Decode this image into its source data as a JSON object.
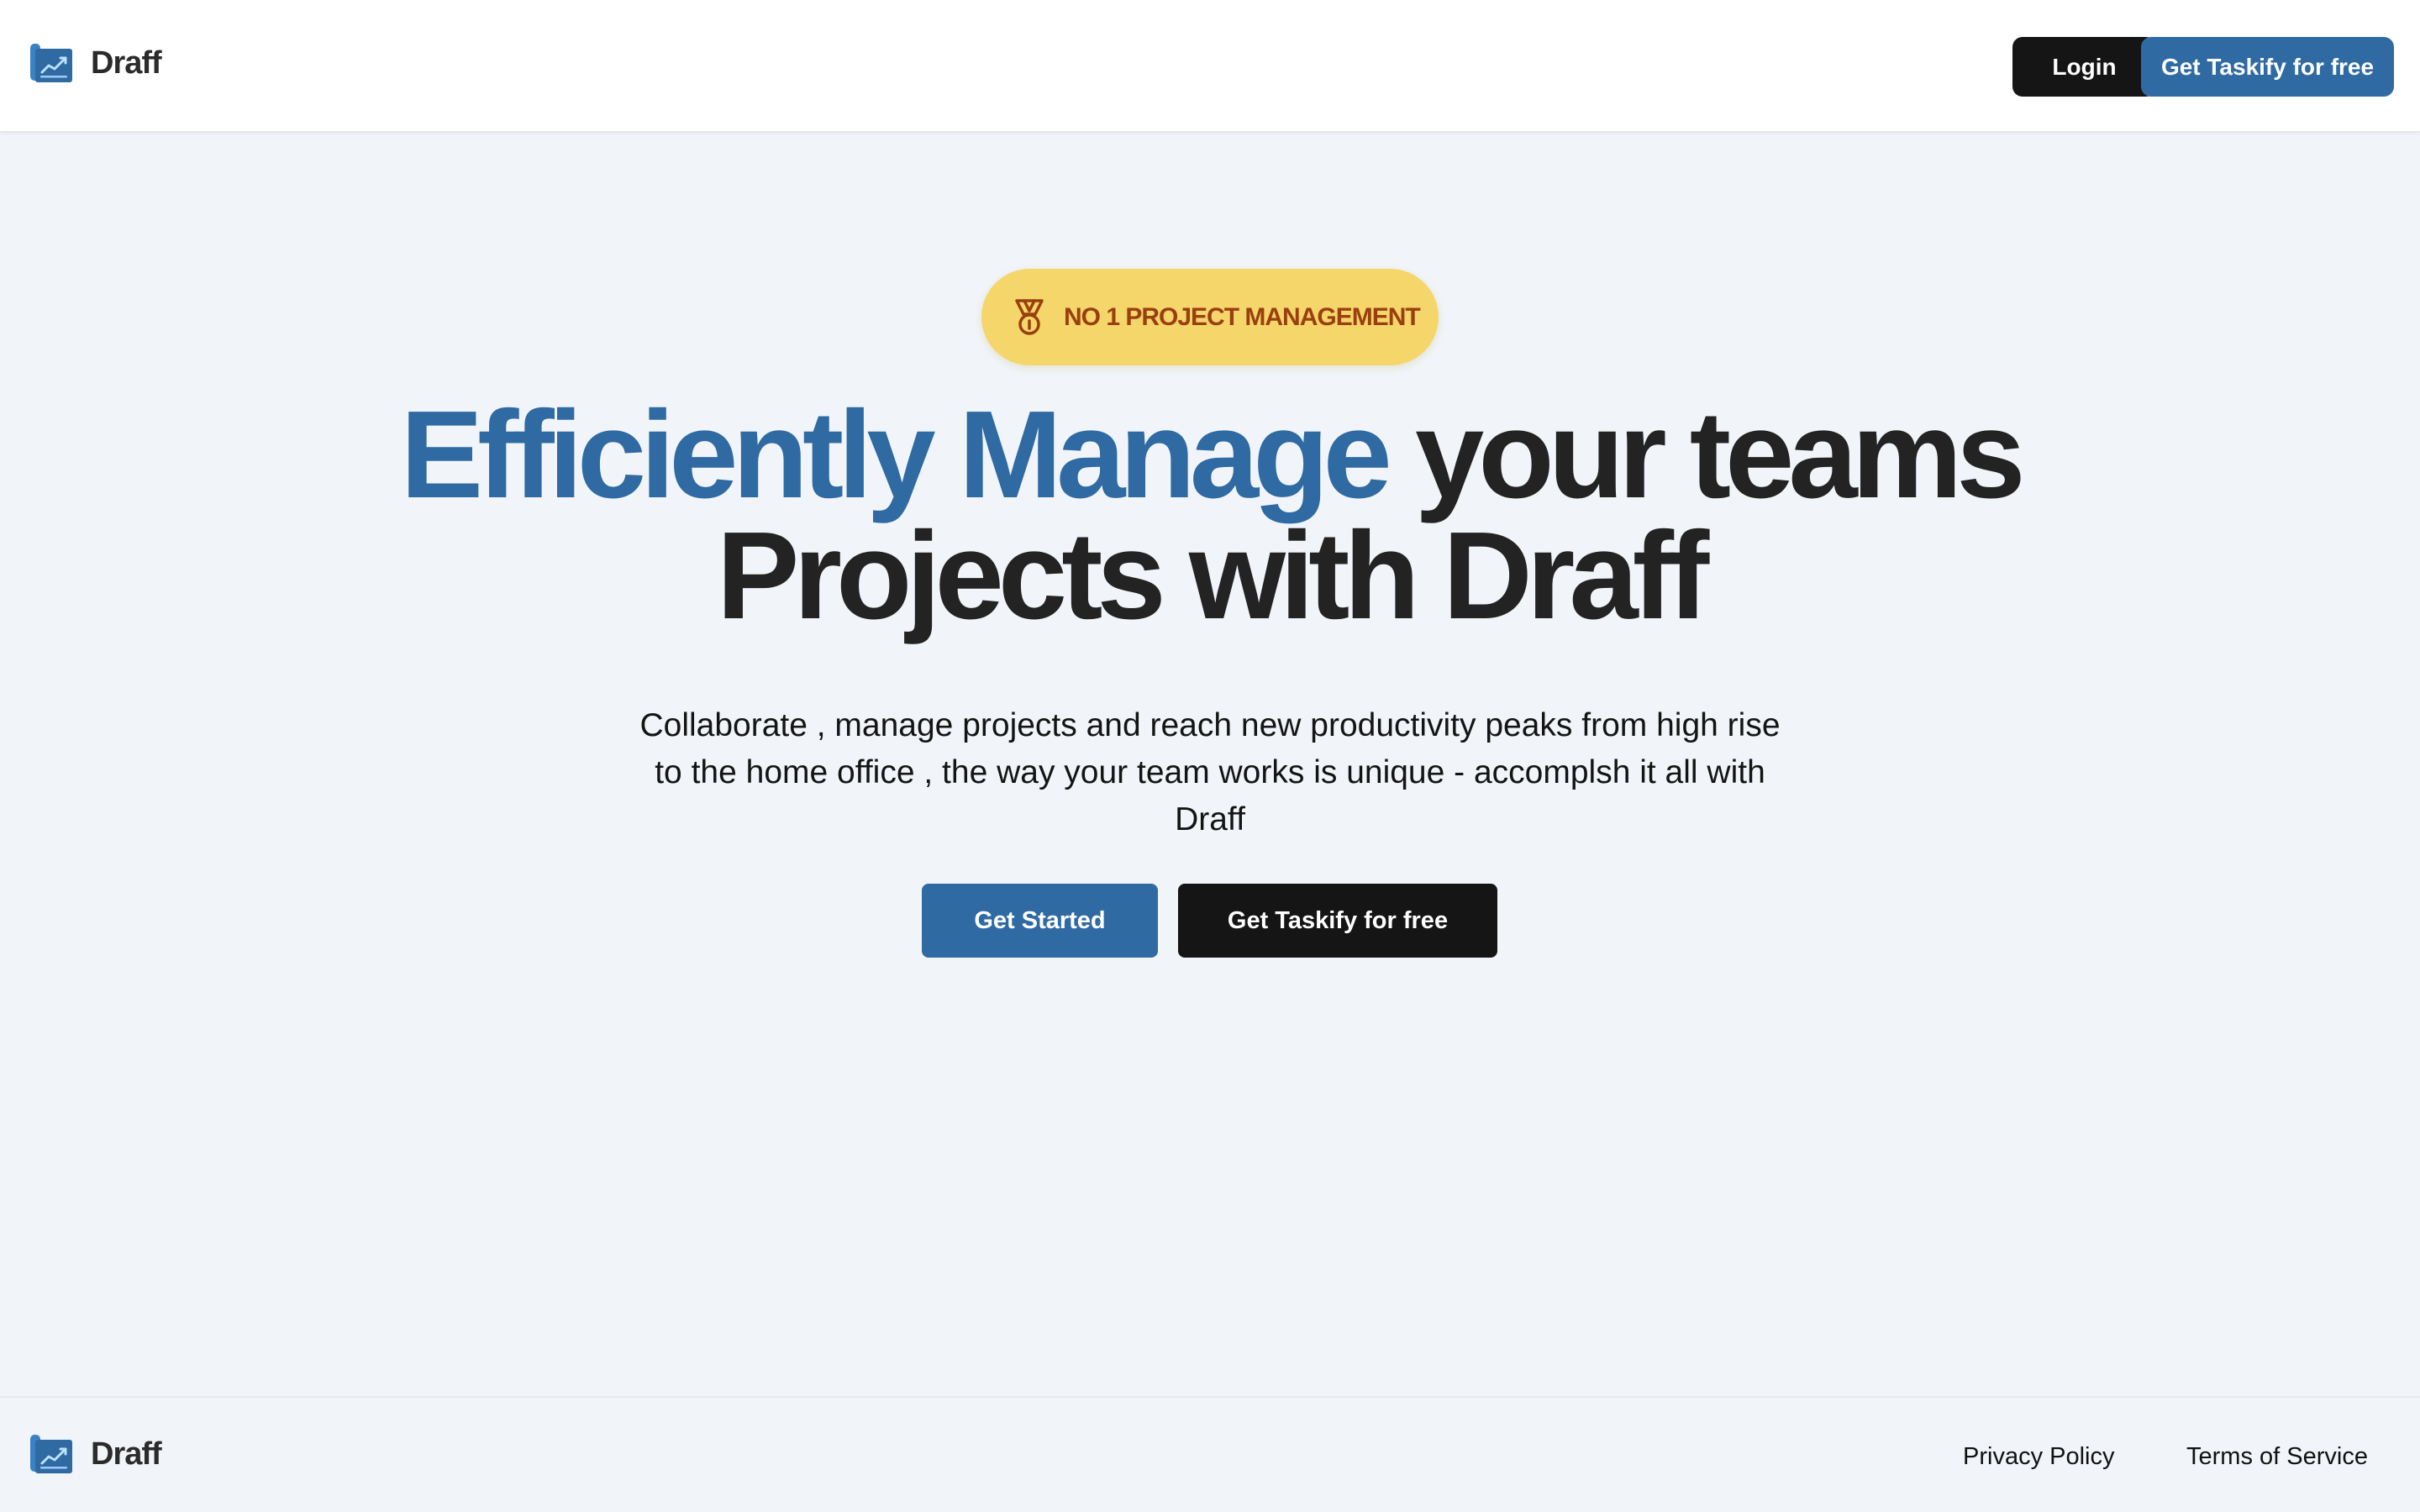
{
  "header": {
    "brand_name": "Draff",
    "brand_icon": "chart-folder-icon",
    "login_label": "Login",
    "cta_label": "Get Taskify for free"
  },
  "hero": {
    "badge": {
      "icon": "medal-icon",
      "text": "NO 1 PROJECT MANAGEMENT"
    },
    "headline": {
      "accent_part": "Efficiently Manage",
      "rest_line1": " your teams",
      "line2": "Projects with Draff"
    },
    "subtitle": "Collaborate , manage projects and reach new productivity peaks from high rise to the home office , the way your team works is unique - accomplsh it all with Draff",
    "primary_button": "Get Started",
    "secondary_button": "Get Taskify for free"
  },
  "footer": {
    "brand_name": "Draff",
    "links": [
      "Privacy Policy",
      "Terms of Service"
    ]
  },
  "colors": {
    "accent_blue": "#2f6aa3",
    "dark": "#151515",
    "badge_bg": "#f5d66a",
    "badge_text": "#9a3f0f",
    "page_bg": "#f1f5f9"
  }
}
